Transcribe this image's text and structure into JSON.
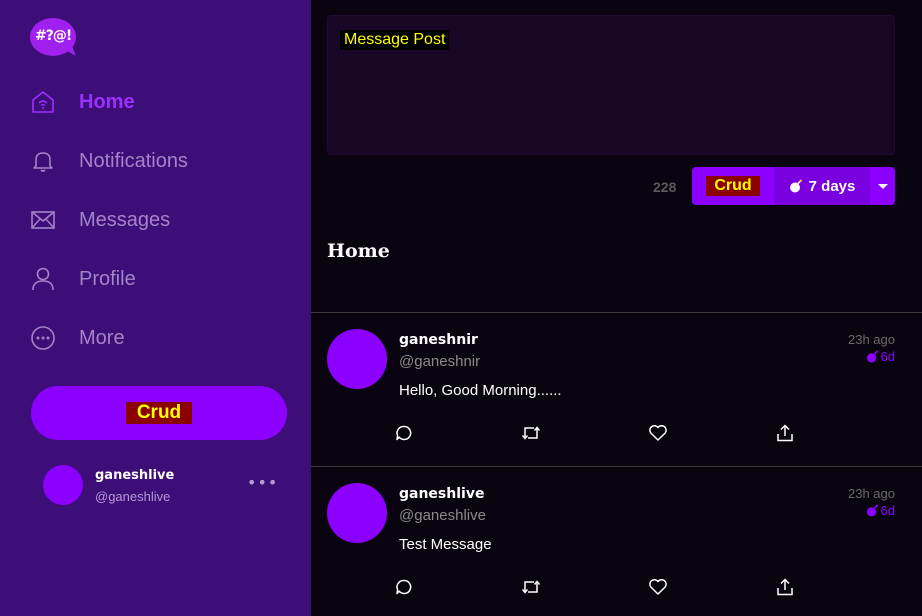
{
  "logo": {
    "text": "#?@!"
  },
  "nav": [
    {
      "label": "Home",
      "icon": "home-icon",
      "active": true
    },
    {
      "label": "Notifications",
      "icon": "bell-icon"
    },
    {
      "label": "Messages",
      "icon": "mail-icon"
    },
    {
      "label": "Profile",
      "icon": "user-icon"
    },
    {
      "label": "More",
      "icon": "more-circle-icon"
    }
  ],
  "sidebar_button": {
    "label": "Crud"
  },
  "account": {
    "name": "ganeshlive",
    "handle": "@ganeshlive",
    "menu": "•••"
  },
  "composer": {
    "placeholder": "Message Post",
    "char_count": "228",
    "post_label": "Crud",
    "duration": "7 days"
  },
  "feed": {
    "title": "Home"
  },
  "posts": [
    {
      "name": "ganeshnir",
      "handle": "@ganeshnir",
      "time": "23h ago",
      "expires": "6d",
      "text": "Hello, Good Morning......"
    },
    {
      "name": "ganeshlive",
      "handle": "@ganeshlive",
      "time": "23h ago",
      "expires": "6d",
      "text": "Test Message"
    }
  ],
  "colors": {
    "sidebar_bg": "#3d0d78",
    "accent": "#8b00ff",
    "main_bg": "#0a0410",
    "highlight_text": "#ffff00",
    "highlight_bg": "#8b0000"
  }
}
